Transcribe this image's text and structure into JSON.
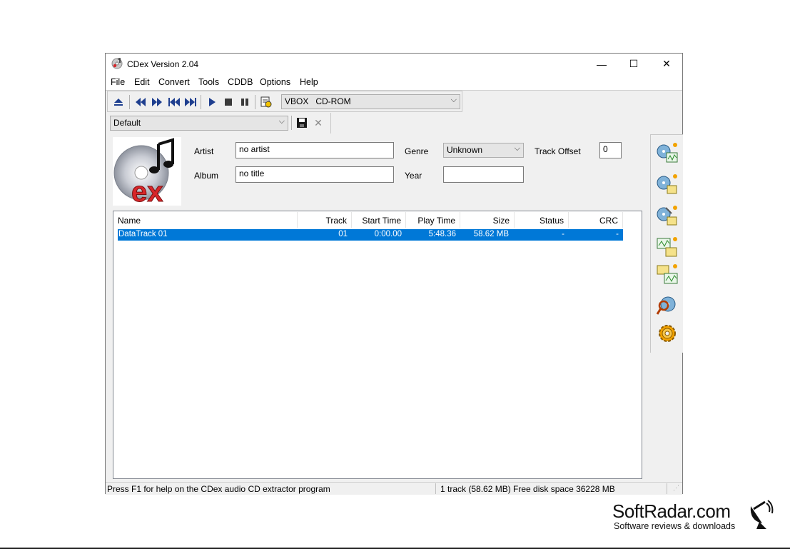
{
  "window": {
    "title": "CDex Version 2.04",
    "minimize_glyph": "—",
    "maximize_glyph": "☐",
    "close_glyph": "✕"
  },
  "menu": [
    "File",
    "Edit",
    "Convert",
    "Tools",
    "CDDB",
    "Options",
    "Help"
  ],
  "toolbar": {
    "drive_select": "VBOX   CD-ROM",
    "profile_select": "Default",
    "icons": [
      "eject-icon",
      "skip-back-icon",
      "skip-forward-icon",
      "prev-track-icon",
      "next-track-icon",
      "play-icon",
      "stop-icon",
      "pause-icon",
      "cddb-info-icon"
    ]
  },
  "album_info": {
    "artist_label": "Artist",
    "artist_value": "no artist",
    "album_label": "Album",
    "album_value": "no title",
    "genre_label": "Genre",
    "genre_value": "Unknown",
    "year_label": "Year",
    "year_value": "",
    "track_offset_label": "Track Offset",
    "track_offset_value": "0"
  },
  "track_list": {
    "columns": [
      "Name",
      "Track",
      "Start Time",
      "Play Time",
      "Size",
      "Status",
      "CRC"
    ],
    "rows": [
      {
        "name": "DataTrack 01",
        "track": "01",
        "start": "0:00.00",
        "play": "5:48.36",
        "size": "58.62 MB",
        "status": "-",
        "crc": "-"
      }
    ]
  },
  "sidebar_icons": [
    "extract-to-wav-icon",
    "extract-to-compressed-icon",
    "extract-partial-icon",
    "convert-wav-icon",
    "convert-compressed-icon",
    "record-icon",
    "settings-icon"
  ],
  "status": {
    "help": "Press F1 for help on the CDex audio CD extractor program",
    "info": "1 track (58.62 MB) Free disk space 36228 MB"
  },
  "watermark": {
    "brand": "SoftRadar.com",
    "tagline": "Software reviews & downloads"
  },
  "colors": {
    "selection": "#0078d7",
    "logo_red": "#d8262a"
  }
}
